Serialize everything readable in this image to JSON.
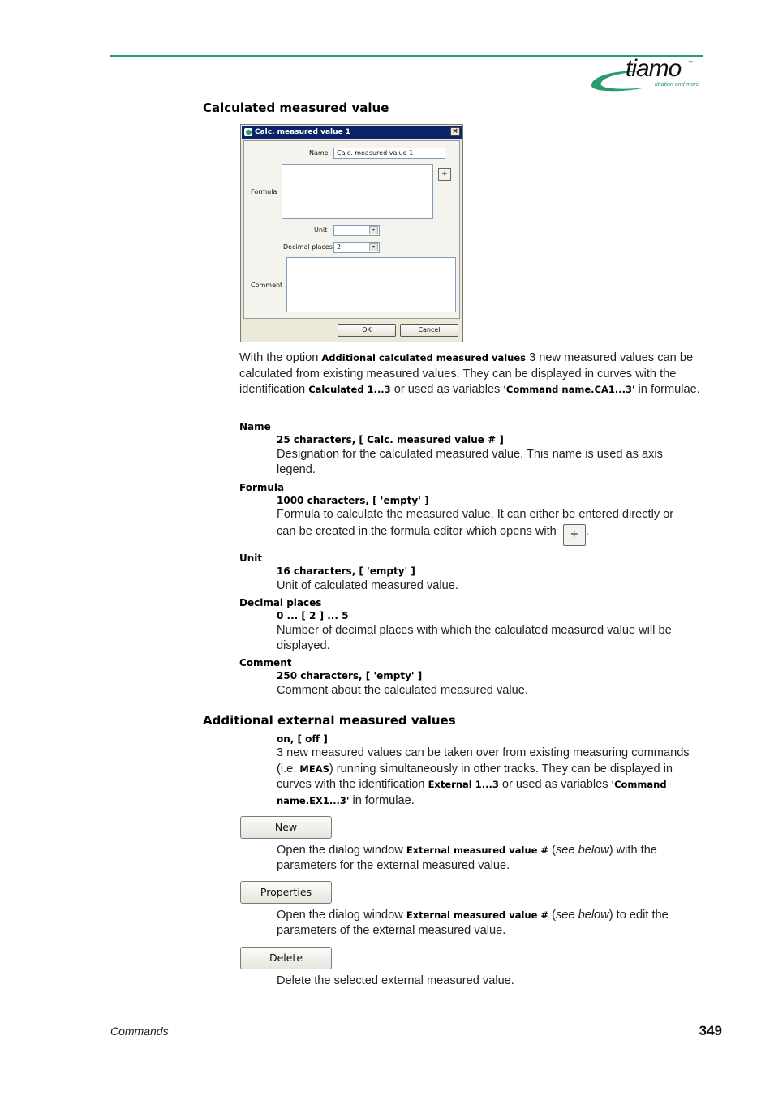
{
  "header": {
    "logo_text": "tiamo",
    "logo_tm": "™",
    "logo_tagline": "titration and more",
    "brand_color": "#2a9b6e"
  },
  "section1": {
    "heading": "Calculated measured value",
    "dialog": {
      "title": "Calc. measured value 1",
      "close_label": "×",
      "name_label": "Name",
      "name_value": "Calc. measured value 1",
      "formula_label": "Formula",
      "formula_value": "",
      "formula_editor_icon": "÷",
      "unit_label": "Unit",
      "unit_value": "",
      "decimal_label": "Decimal places",
      "decimal_value": "2",
      "comment_label": "Comment",
      "comment_value": "",
      "ok_label": "OK",
      "cancel_label": "Cancel",
      "dropdown_arrow": "▾"
    },
    "intro": {
      "t1": "With the option ",
      "b1": "Additional calculated measured values",
      "t2": " 3 new measured values can be calculated from existing measured values. They can be displayed in curves with the identification ",
      "b2": "Calculated 1...3",
      "t3": " or used as variables ",
      "b3": "'Command name.CA1...3'",
      "t4": " in formulae."
    },
    "params": [
      {
        "name": "Name",
        "range": "25 characters, [ Calc. measured value # ]",
        "desc": "Designation for the calculated measured value. This name is used as axis legend."
      },
      {
        "name": "Formula",
        "range": "1000 characters, [ 'empty' ]",
        "desc1": "Formula to calculate the measured value. It can either be entered directly or",
        "desc2": "can be created in the formula editor which opens with",
        "desc_end": ".",
        "icon": "÷"
      },
      {
        "name": "Unit",
        "range": "16 characters, [ 'empty' ]",
        "desc": "Unit of calculated measured value."
      },
      {
        "name": "Decimal places",
        "range": "0 ... [ 2 ] ... 5",
        "desc": "Number of decimal places with which the calculated measured value will be displayed."
      },
      {
        "name": "Comment",
        "range": "250 characters, [ 'empty' ]",
        "desc": "Comment about the calculated measured value."
      }
    ]
  },
  "section2": {
    "heading": "Additional external measured values",
    "range": "on, [ off ]",
    "text": {
      "t1": "3 new measured values can be taken over from existing measuring commands (i.e. ",
      "b1": "MEAS",
      "t2": ") running simultaneously in other tracks. They can be displayed in curves with the identification ",
      "b2": "External 1...3",
      "t3": " or used as variables ",
      "b3": "'Command name.EX1...3'",
      "t4": " in formulae."
    },
    "buttons": [
      {
        "label": "New",
        "d1": "Open the dialog window ",
        "db": "External measured value #",
        "d2": " (",
        "di": "see below",
        "d3": ") with the parameters for the external measured value."
      },
      {
        "label": "Properties",
        "d1": "Open the dialog window ",
        "db": "External measured value #",
        "d2": " (",
        "di": "see below",
        "d3": ") to edit the parameters of the external measured value."
      },
      {
        "label": "Delete",
        "d": "Delete the selected external measured value."
      }
    ]
  },
  "footer": {
    "section": "Commands",
    "page": "349"
  }
}
